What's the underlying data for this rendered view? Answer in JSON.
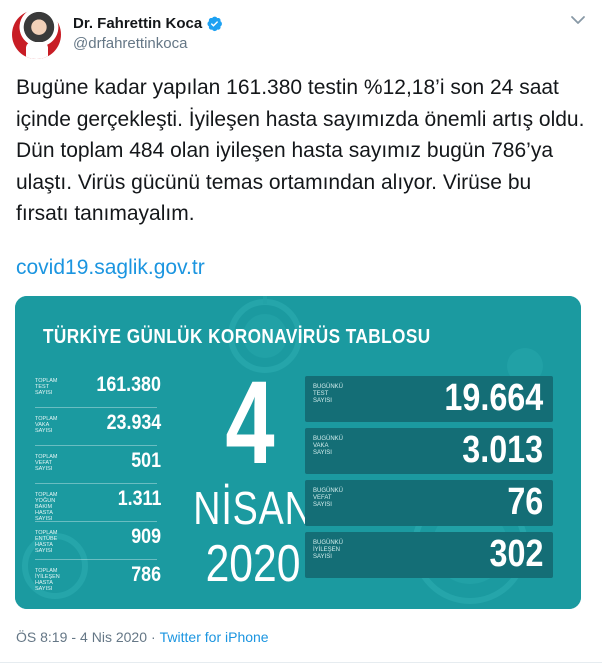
{
  "author": {
    "name": "Dr. Fahrettin Koca",
    "handle": "@drfahrettinkoca",
    "verified": true,
    "avatar_icon": "profile-photo"
  },
  "tweet": {
    "text": "Bugüne kadar yapılan 161.380 testin %12,18’i son 24 saat içinde gerçekleşti. İyileşen hasta sayımızda önemli artış oldu. Dün toplam 484 olan iyileşen hasta sayımız bugün 786’ya ulaştı. Virüs gücünü temas ortamından alıyor. Virüse bu fırsatı tanımayalım.",
    "link": "covid19.saglik.gov.tr"
  },
  "infographic": {
    "title": "TÜRKİYE GÜNLÜK KORONAVİRÜS TABLOSU",
    "day": "4",
    "month": "NİSAN",
    "year": "2020",
    "totals": [
      {
        "label": "TOPLAM\nTEST\nSAYISI",
        "value": "161.380"
      },
      {
        "label": "TOPLAM\nVAKA\nSAYISI",
        "value": "23.934"
      },
      {
        "label": "TOPLAM\nVEFAT\nSAYISI",
        "value": "501"
      },
      {
        "label": "TOPLAM\nYOĞUN BAKIM\nHASTA SAYISI",
        "value": "1.311"
      },
      {
        "label": "TOPLAM\nENTÜBE\nHASTA SAYISI",
        "value": "909"
      },
      {
        "label": "TOPLAM\nİYİLEŞEN\nHASTA SAYISI",
        "value": "786"
      }
    ],
    "daily": [
      {
        "label": "BUGÜNKÜ\nTEST\nSAYISI",
        "value": "19.664"
      },
      {
        "label": "BUGÜNKÜ\nVAKA\nSAYISI",
        "value": "3.013"
      },
      {
        "label": "BUGÜNKÜ\nVEFAT\nSAYISI",
        "value": "76"
      },
      {
        "label": "BUGÜNKÜ\nİYİLEŞEN\nSAYISI",
        "value": "302"
      }
    ],
    "colors": {
      "background": "#1b9aa0",
      "panel": "#146e76"
    }
  },
  "meta": {
    "time": "ÖS 8:19",
    "separator": "-",
    "date": "4 Nis 2020",
    "source": "Twitter for iPhone"
  }
}
